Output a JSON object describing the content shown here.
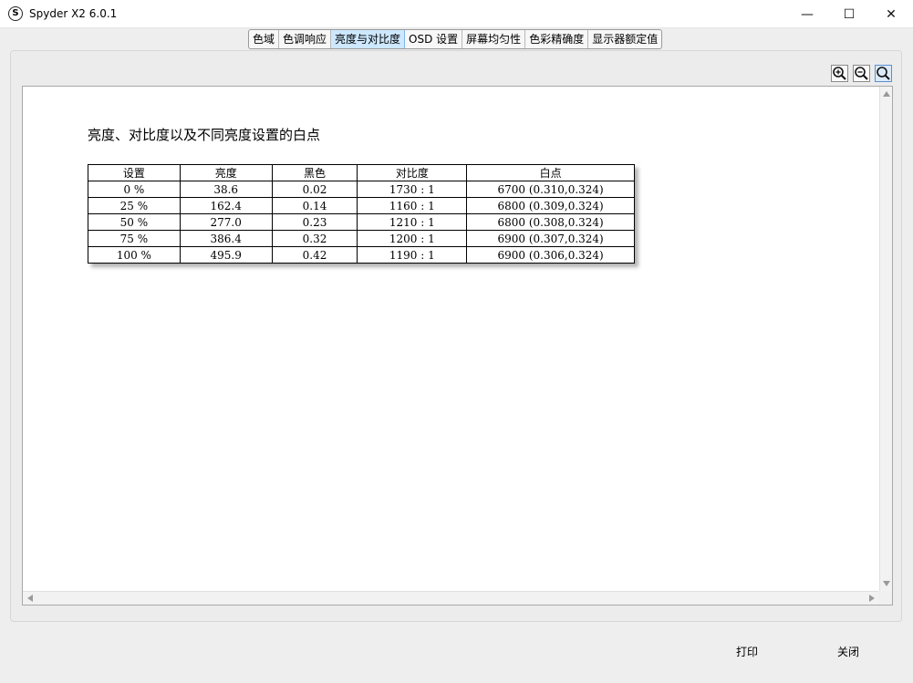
{
  "window": {
    "title": "Spyder X2 6.0.1",
    "icon_letter": "S",
    "controls": {
      "minimize": "—",
      "maximize": "☐",
      "close": "✕"
    }
  },
  "tabs": [
    {
      "label": "色域"
    },
    {
      "label": "色调响应"
    },
    {
      "label": "亮度与对比度",
      "active": true
    },
    {
      "label": "OSD 设置"
    },
    {
      "label": "屏幕均匀性"
    },
    {
      "label": "色彩精确度"
    },
    {
      "label": "显示器额定值"
    }
  ],
  "zoom_icons": [
    "zoom-in-icon",
    "zoom-out-icon",
    "zoom-fit-icon"
  ],
  "report": {
    "title": "亮度、对比度以及不同亮度设置的白点",
    "columns": [
      "设置",
      "亮度",
      "黑色",
      "对比度",
      "白点"
    ],
    "rows": [
      [
        "0 %",
        "38.6",
        "0.02",
        "1730 : 1",
        "6700 (0.310,0.324)"
      ],
      [
        "25 %",
        "162.4",
        "0.14",
        "1160 : 1",
        "6800 (0.309,0.324)"
      ],
      [
        "50 %",
        "277.0",
        "0.23",
        "1210 : 1",
        "6800 (0.308,0.324)"
      ],
      [
        "75 %",
        "386.4",
        "0.32",
        "1200 : 1",
        "6900 (0.307,0.324)"
      ],
      [
        "100 %",
        "495.9",
        "0.42",
        "1190 : 1",
        "6900 (0.306,0.324)"
      ]
    ]
  },
  "buttons": {
    "print": "打印",
    "close": "关闭"
  },
  "colors": {
    "active_tab": "#cde8ff",
    "window_bg": "#eeeeee",
    "viewer_bg": "#ffffff"
  }
}
